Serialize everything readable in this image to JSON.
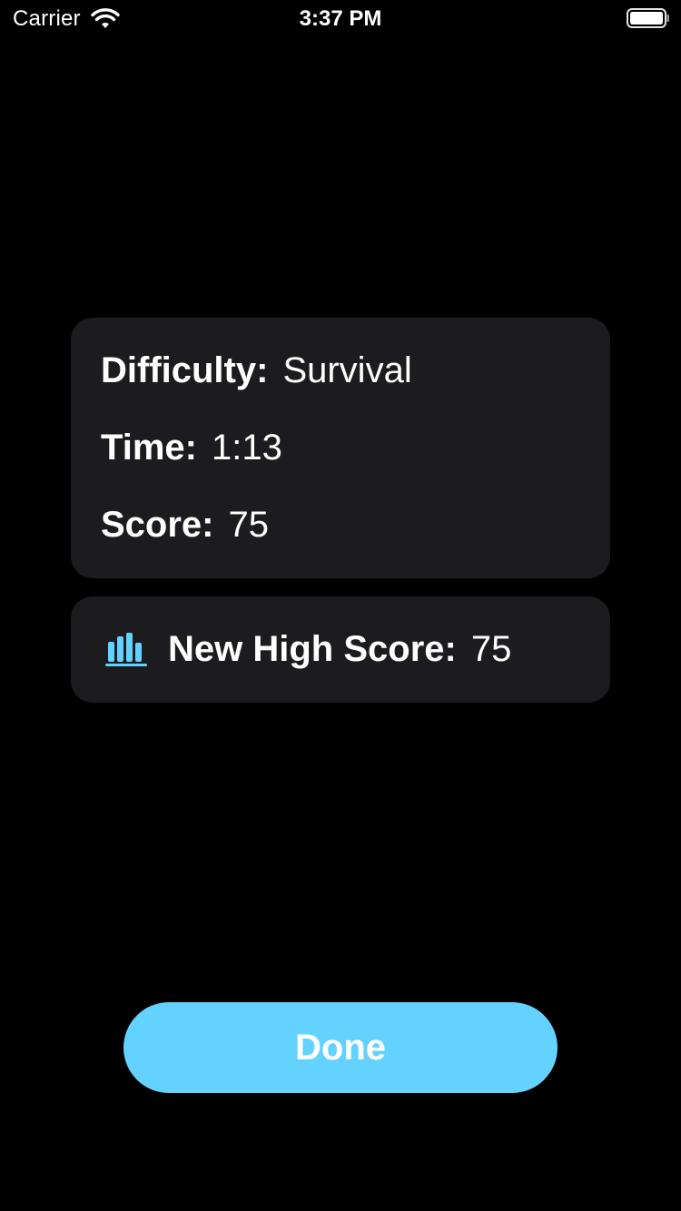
{
  "status_bar": {
    "carrier": "Carrier",
    "time": "3:37 PM",
    "icons": [
      "wifi-icon",
      "battery-icon"
    ]
  },
  "results": {
    "difficulty": {
      "label": "Difficulty:",
      "value": "Survival"
    },
    "time": {
      "label": "Time:",
      "value": "1:13"
    },
    "score": {
      "label": "Score:",
      "value": "75"
    }
  },
  "high_score": {
    "icon": "bar-chart-icon",
    "label": "New High Score:",
    "value": "75"
  },
  "done_button": {
    "label": "Done"
  },
  "colors": {
    "background": "#000000",
    "card": "#1c1c1e",
    "accent": "#64d2ff",
    "text": "#ffffff"
  }
}
